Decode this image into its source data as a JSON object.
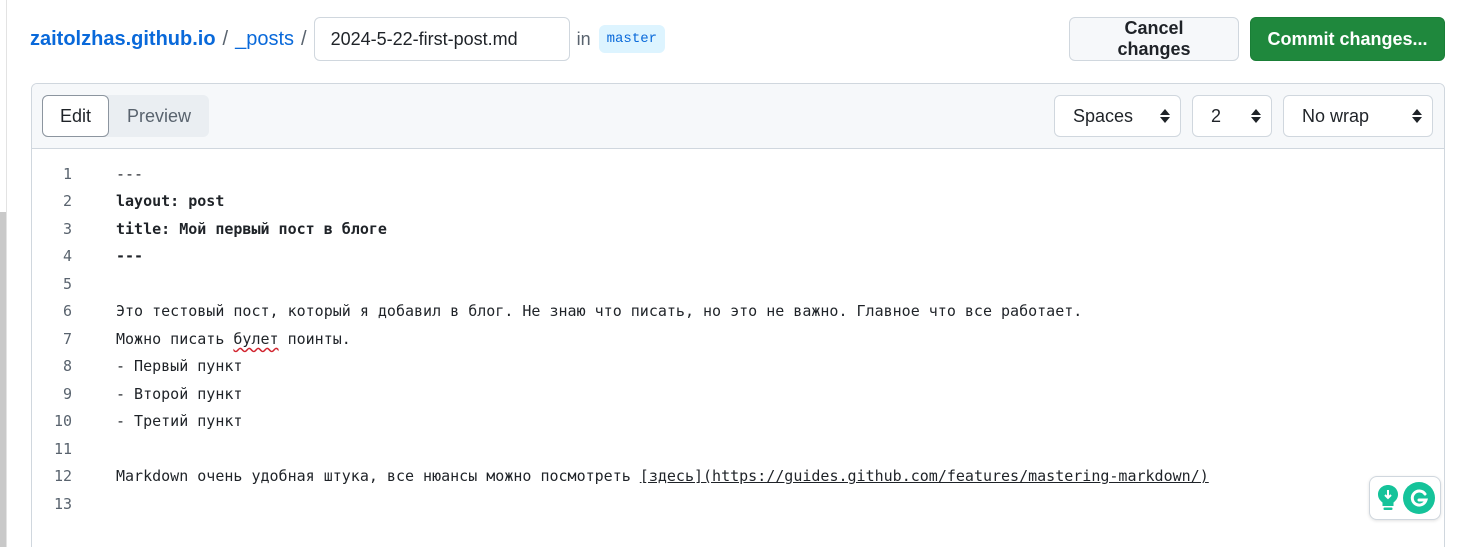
{
  "breadcrumb": {
    "repo": "zaitolzhas.github.io",
    "separator": "/",
    "folder": "_posts"
  },
  "filename": "2024-5-22-first-post.md",
  "branch": {
    "in_label": "in",
    "name": "master"
  },
  "actions": {
    "cancel_label": "Cancel changes",
    "commit_label": "Commit changes..."
  },
  "tabs": [
    {
      "label": "Edit",
      "active": true
    },
    {
      "label": "Preview",
      "active": false
    }
  ],
  "selects": {
    "indent_mode": "Spaces",
    "indent_size": "2",
    "wrap_mode": "No wrap"
  },
  "code_lines": [
    {
      "n": "1",
      "text": "---"
    },
    {
      "n": "2",
      "key": "layout:",
      "val": " post"
    },
    {
      "n": "3",
      "key": "title:",
      "val": " Мой первый пост в блоге"
    },
    {
      "n": "4",
      "text": "---"
    },
    {
      "n": "5",
      "text": ""
    },
    {
      "n": "6",
      "text": "Это тестовый пост, который я добавил в блог. Не знаю что писать, но это не важно. Главное что все работает."
    },
    {
      "n": "7",
      "pre": "Можно писать ",
      "err": "булет",
      "post": " поинты."
    },
    {
      "n": "8",
      "text": "- Первый пункт"
    },
    {
      "n": "9",
      "text": "- Второй пункт"
    },
    {
      "n": "10",
      "text": "- Третий пункт"
    },
    {
      "n": "11",
      "text": ""
    },
    {
      "n": "12",
      "pre": "Markdown очень удобная штука, все нюансы можно посмотреть ",
      "link_text": "[здесь]",
      "link_url": "(https://guides.github.com/features/mastering-markdown/)"
    },
    {
      "n": "13",
      "text": ""
    }
  ],
  "colors": {
    "link": "#0969da",
    "commit_button": "#1f883d",
    "branch_bg": "#ddf4ff",
    "grammarly": "#15c39a"
  },
  "widgets": {
    "bulb": "lightbulb-icon",
    "grammarly": "grammarly-icon"
  }
}
